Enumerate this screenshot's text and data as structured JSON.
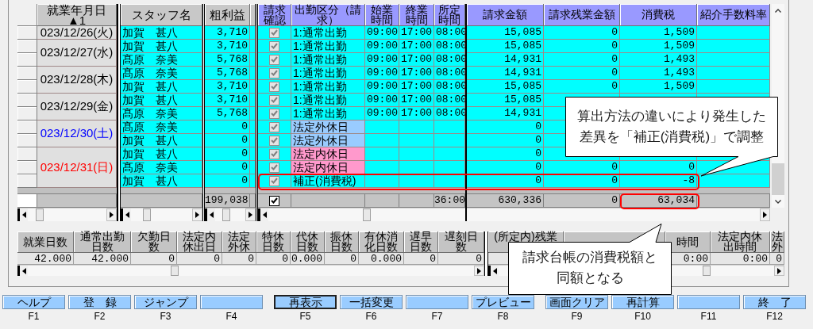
{
  "grid": {
    "columns": [
      "就業年月日▲1",
      "スタッフ名",
      "粗利益",
      "請求確認",
      "出勤区分（請求）",
      "始業時間",
      "終業時間",
      "所定時間",
      "請求金額",
      "請求残業金額",
      "消費税",
      "紹介手数料率"
    ],
    "groups": [
      {
        "date": "023/12/26(火)",
        "color": "#000000",
        "rows": [
          {
            "staff": "加賀　甚八",
            "gross": "3,710",
            "checked": true,
            "attendance": "1:通常出勤",
            "kind": "normal",
            "start": "09:00",
            "end": "17:00",
            "scheduled": "08:00",
            "billing": "15,085",
            "overtime": "0",
            "tax": "1,509"
          }
        ]
      },
      {
        "date": "023/12/27(水)",
        "color": "#000000",
        "rows": [
          {
            "staff": "加賀　甚八",
            "gross": "3,710",
            "checked": true,
            "attendance": "1:通常出勤",
            "kind": "normal",
            "start": "09:00",
            "end": "17:00",
            "scheduled": "08:00",
            "billing": "15,085",
            "overtime": "0",
            "tax": "1,509"
          },
          {
            "staff": "髙原　奈美",
            "gross": "5,768",
            "checked": true,
            "attendance": "1:通常出勤",
            "kind": "normal",
            "start": "09:00",
            "end": "17:00",
            "scheduled": "08:00",
            "billing": "14,931",
            "overtime": "0",
            "tax": "1,493"
          }
        ]
      },
      {
        "date": "023/12/28(木)",
        "color": "#000000",
        "rows": [
          {
            "staff": "髙原　奈美",
            "gross": "5,768",
            "checked": true,
            "attendance": "1:通常出勤",
            "kind": "normal",
            "start": "09:00",
            "end": "17:00",
            "scheduled": "08:00",
            "billing": "14,931",
            "overtime": "0",
            "tax": "1,493"
          },
          {
            "staff": "加賀　甚八",
            "gross": "3,710",
            "checked": true,
            "attendance": "1:通常出勤",
            "kind": "normal",
            "start": "09:00",
            "end": "17:00",
            "scheduled": "08:00",
            "billing": "15,085",
            "overtime": "0",
            "tax": "1,509"
          }
        ]
      },
      {
        "date": "023/12/29(金)",
        "color": "#000000",
        "rows": [
          {
            "staff": "加賀　甚八",
            "gross": "3,710",
            "checked": true,
            "attendance": "1:通常出勤",
            "kind": "normal",
            "start": "09:00",
            "end": "17:00",
            "scheduled": "08:00",
            "billing": "15,085"
          },
          {
            "staff": "髙原　奈美",
            "gross": "5,768",
            "checked": true,
            "attendance": "1:通常出勤",
            "kind": "normal",
            "start": "09:00",
            "end": "17:00",
            "scheduled": "08:00",
            "billing": "14,931"
          }
        ]
      },
      {
        "date": "023/12/30(土)",
        "color": "#0000ff",
        "rows": [
          {
            "staff": "髙原　奈美",
            "gross": "0",
            "checked": true,
            "attendance": "法定外休日",
            "kind": "outside_holiday",
            "billing": "0"
          },
          {
            "staff": "加賀　甚八",
            "gross": "0",
            "checked": true,
            "attendance": "法定外休日",
            "kind": "outside_holiday",
            "billing": "0"
          }
        ]
      },
      {
        "date": "023/12/31(日)",
        "color": "#ff0000",
        "rows": [
          {
            "staff": "加賀　甚八",
            "gross": "0",
            "checked": true,
            "attendance": "法定内休日",
            "kind": "inside_holiday",
            "billing": "0"
          },
          {
            "staff": "髙原　奈美",
            "gross": "0",
            "checked": true,
            "attendance": "法定内休日",
            "kind": "inside_holiday",
            "billing": "0",
            "overtime": "0",
            "tax": "0"
          },
          {
            "staff": "加賀　甚八",
            "gross": "0",
            "checked": true,
            "attendance": "補正(消費税)",
            "kind": "adjustment",
            "billing": "0",
            "overtime": "0",
            "tax": "-8"
          }
        ]
      }
    ],
    "totals": {
      "gross": "199,038",
      "checked": true,
      "scheduled": "36:00",
      "billing": "630,336",
      "overtime": "0",
      "tax": "63,034"
    }
  },
  "summary": {
    "columns": [
      {
        "header": "就業日数",
        "value": "42.000"
      },
      {
        "header": "通常出勤日数",
        "value": "42.000"
      },
      {
        "header": "欠勤日数",
        "value": "0"
      },
      {
        "header": "法定内休出日",
        "value": "0"
      },
      {
        "header": "法定外休",
        "value": "0"
      },
      {
        "header": "特休日数",
        "value": "0"
      },
      {
        "header": "代休日数",
        "value": "0.000"
      },
      {
        "header": "振休日数",
        "value": "0"
      },
      {
        "header": "有休消化日数",
        "value": "0.000"
      },
      {
        "header": "遅早日数",
        "value": "0"
      },
      {
        "header": "遅刻日数",
        "value": "0"
      },
      {
        "header": "(所定内)残業"
      },
      {
        "header": "時間",
        "value": "0:00"
      },
      {
        "header": "法定内休出時間",
        "value": "0:00"
      },
      {
        "header": "法外",
        "value": "0"
      }
    ]
  },
  "callouts": [
    {
      "text": "算出方法の違いにより発生した差異を「補正(消費税)」で調整"
    },
    {
      "text": "請求台帳の消費税額と同額となる"
    }
  ],
  "function_keys": [
    {
      "label": "ヘルプ",
      "key": "F1",
      "focused": false
    },
    {
      "label": "登　録",
      "key": "F2",
      "focused": false
    },
    {
      "label": "ジャンプ",
      "key": "F3",
      "focused": false
    },
    {
      "key": "F4",
      "focused": false
    },
    {
      "label": "再表示",
      "key": "F5",
      "focused": true
    },
    {
      "label": "一括変更",
      "key": "F6",
      "focused": false
    },
    {
      "key": "F7",
      "focused": false
    },
    {
      "label": "プレビュー",
      "key": "F8",
      "focused": false
    },
    {
      "label": "画面クリア",
      "key": "F9",
      "focused": false
    },
    {
      "label": "再計算",
      "key": "F10",
      "focused": false
    },
    {
      "key": "F11",
      "focused": false
    },
    {
      "label": "終　了",
      "key": "F12",
      "focused": false
    }
  ]
}
